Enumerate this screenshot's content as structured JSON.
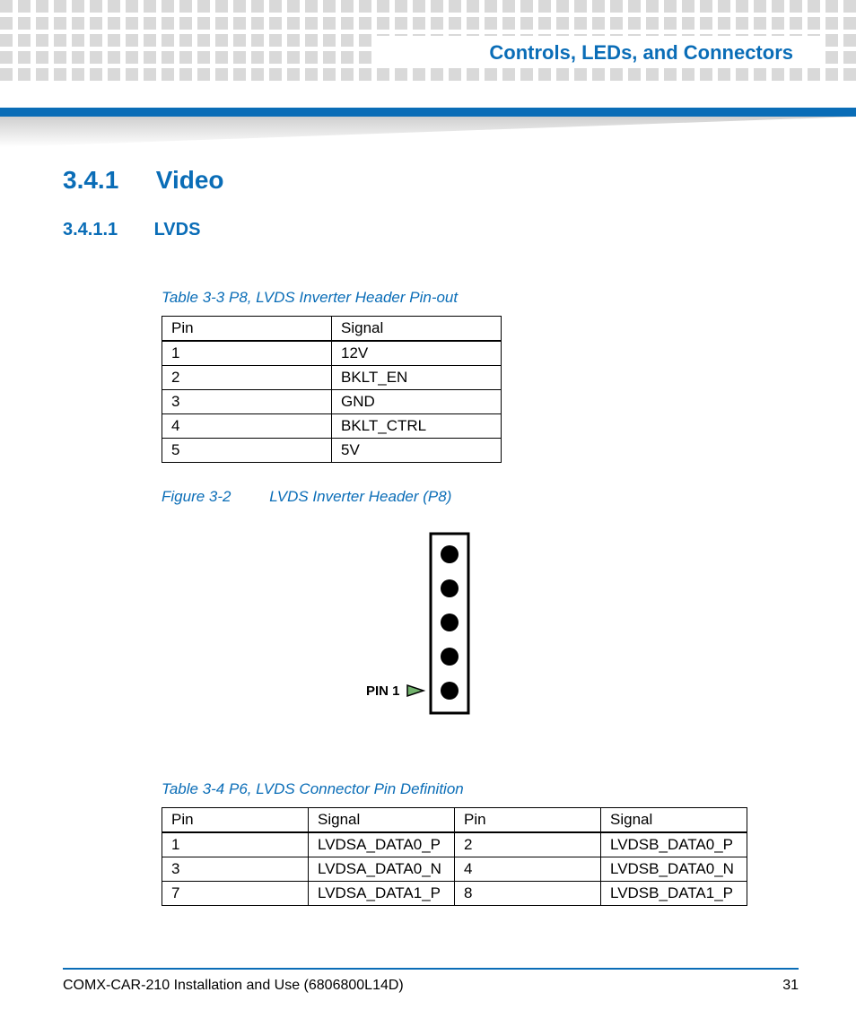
{
  "header": {
    "title": "Controls, LEDs, and Connectors"
  },
  "section_341": {
    "num": "3.4.1",
    "title": "Video"
  },
  "section_3411": {
    "num": "3.4.1.1",
    "title": "LVDS"
  },
  "table33": {
    "caption": "Table 3-3 P8, LVDS Inverter Header Pin-out",
    "head": {
      "c1": "Pin",
      "c2": "Signal"
    },
    "rows": [
      {
        "c1": "1",
        "c2": "12V"
      },
      {
        "c1": "2",
        "c2": "BKLT_EN"
      },
      {
        "c1": "3",
        "c2": "GND"
      },
      {
        "c1": "4",
        "c2": "BKLT_CTRL"
      },
      {
        "c1": "5",
        "c2": "5V"
      }
    ]
  },
  "figure32": {
    "num": "Figure 3-2",
    "title": "LVDS Inverter Header (P8)",
    "pin_label": "PIN 1"
  },
  "table34": {
    "caption": "Table 3-4 P6, LVDS Connector Pin Definition",
    "head": {
      "c1": "Pin",
      "c2": "Signal",
      "c3": "Pin",
      "c4": "Signal"
    },
    "rows": [
      {
        "c1": "1",
        "c2": "LVDSA_DATA0_P",
        "c3": "2",
        "c4": "LVDSB_DATA0_P"
      },
      {
        "c1": "3",
        "c2": "LVDSA_DATA0_N",
        "c3": "4",
        "c4": "LVDSB_DATA0_N"
      },
      {
        "c1": "7",
        "c2": "LVDSA_DATA1_P",
        "c3": "8",
        "c4": "LVDSB_DATA1_P"
      }
    ]
  },
  "footer": {
    "text": "COMX-CAR-210 Installation and Use (6806800L14D)",
    "page": "31"
  }
}
